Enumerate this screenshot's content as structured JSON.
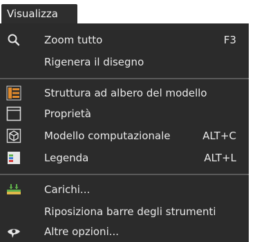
{
  "menubar": {
    "tab_label": "Visualizza"
  },
  "menu": {
    "items": [
      {
        "label": "Zoom tutto",
        "shortcut": "F3",
        "icon": "search-icon"
      },
      {
        "label": "Rigenera il disegno",
        "shortcut": ""
      },
      {
        "label": "Struttura ad albero del modello",
        "shortcut": "",
        "icon": "tree-structure-icon"
      },
      {
        "label": "Proprietà",
        "shortcut": "",
        "icon": "properties-panel-icon"
      },
      {
        "label": "Modello computazionale",
        "shortcut": "ALT+C",
        "icon": "cube-icon"
      },
      {
        "label": "Legenda",
        "shortcut": "ALT+L",
        "icon": "legend-icon"
      },
      {
        "label": "Carichi...",
        "shortcut": "",
        "icon": "loads-icon"
      },
      {
        "label": "Riposiziona barre degli strumenti",
        "shortcut": ""
      },
      {
        "label": "Altre opzioni...",
        "shortcut": "",
        "icon": "eye-icon"
      }
    ]
  },
  "colors": {
    "menu_background": "#2b2b2b",
    "text": "#e9e9e9",
    "separator": "#5a5a5a",
    "tree_icon_accent": "#e08a2c",
    "loads_icon_green": "#5fb04b"
  }
}
